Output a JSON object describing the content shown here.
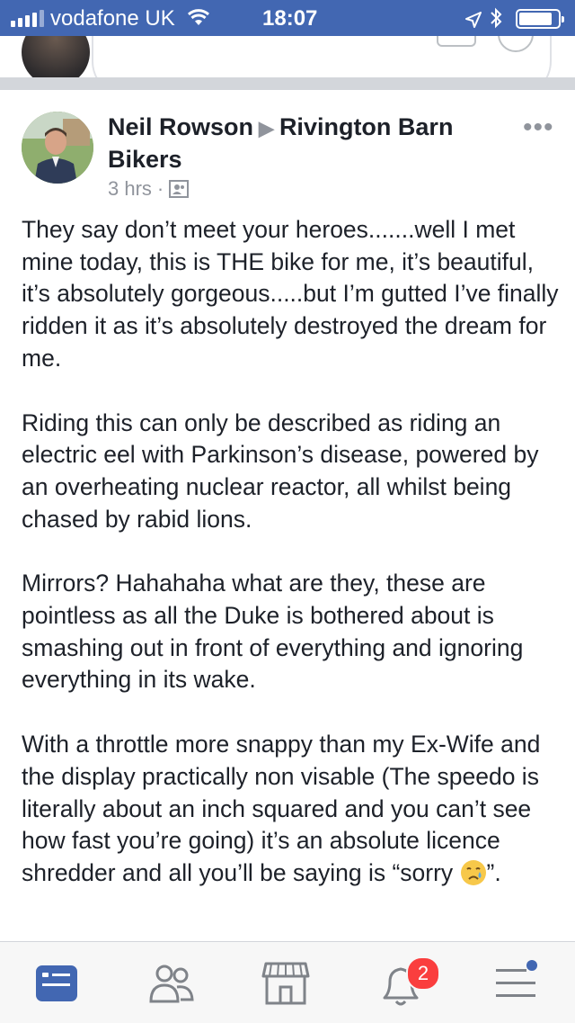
{
  "status_bar": {
    "carrier": "vodafone UK",
    "time": "18:07"
  },
  "post": {
    "author": "Neil Rowson",
    "group": "Rivington Barn Bikers",
    "time": "3 hrs",
    "separator": "·",
    "paragraphs": [
      "They say don’t meet your heroes.......well I met mine today, this is THE bike for me, it’s beautiful, it’s absolutely gorgeous.....but I’m gutted I’ve finally ridden it as it’s absolutely destroyed the dream for me.",
      "Riding this can only be described as riding an electric eel with Parkinson’s disease, powered by an overheating nuclear reactor, all whilst being chased by rabid lions.",
      "Mirrors? Hahahaha what are they, these are pointless as all the Duke is bothered about is smashing out in front of everything and ignoring everything in its wake.",
      "With a throttle more snappy than my Ex-Wife and the display practically non visable (The speedo is literally about an inch squared and you can’t see how fast you’re going) it’s an absolute licence shredder and all you’ll be saying is “sorry "
    ],
    "closing_quote": "”.",
    "emoji": "crying-face"
  },
  "tab_bar": {
    "notifications_badge": "2"
  },
  "colors": {
    "brand": "#4267b2",
    "badge": "#fa3e3e",
    "secondary_text": "#90949c"
  }
}
